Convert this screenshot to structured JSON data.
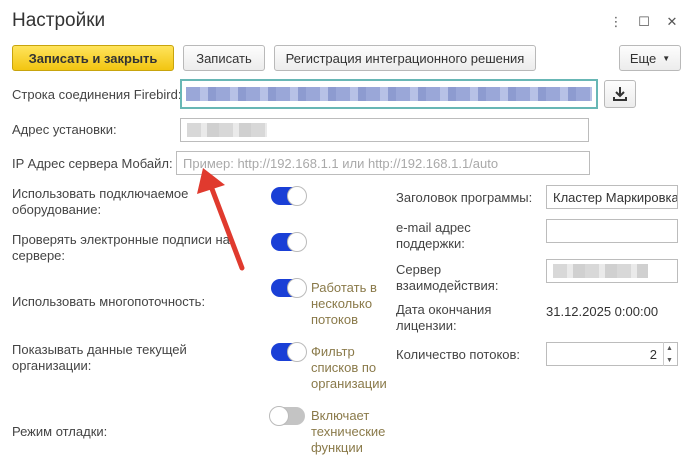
{
  "window": {
    "title": "Настройки",
    "icons": {
      "more": "⋮",
      "maximize": "☐",
      "close": "✕"
    }
  },
  "toolbar": {
    "save_close_label": "Записать и закрыть",
    "save_label": "Записать",
    "register_label": "Регистрация интеграционного решения",
    "more_label": "Еще"
  },
  "fields": {
    "firebird_label": "Строка соединения Firebird:",
    "install_path_label": "Адрес установки:",
    "mobile_ip_label": "IP Адрес сервера Мобайл:",
    "mobile_ip_placeholder": "Пример: http://192.168.1.1 или http://192.168.1.1/auto"
  },
  "left_settings": [
    {
      "label": "Использовать подключаемое оборудование:",
      "on": true,
      "hint": ""
    },
    {
      "label": "Проверять электронные подписи на сервере:",
      "on": true,
      "hint": ""
    },
    {
      "label": "Использовать многопоточность:",
      "on": true,
      "hint": "Работать в несколько потоков"
    },
    {
      "label": "Показывать данные текущей организации:",
      "on": true,
      "hint": "Фильтр списков по организации"
    },
    {
      "label": "Режим отладки:",
      "on": false,
      "hint": "Включает технические функции"
    }
  ],
  "right_settings": {
    "program_title_label": "Заголовок программы:",
    "program_title_value": "Кластер Маркировка",
    "support_email_label": "e-mail адрес поддержки:",
    "support_email_value": "",
    "interaction_server_label": "Сервер взаимодействия:",
    "license_end_label": "Дата окончания лицензии:",
    "license_end_value": "31.12.2025 0:00:00",
    "threads_label": "Количество потоков:",
    "threads_value": "2"
  },
  "colors": {
    "accent_toggle": "#1a3fd6",
    "primary_button": "#f2c511",
    "focus_border": "#68b7b5",
    "annotation_arrow": "#e03a2e"
  }
}
